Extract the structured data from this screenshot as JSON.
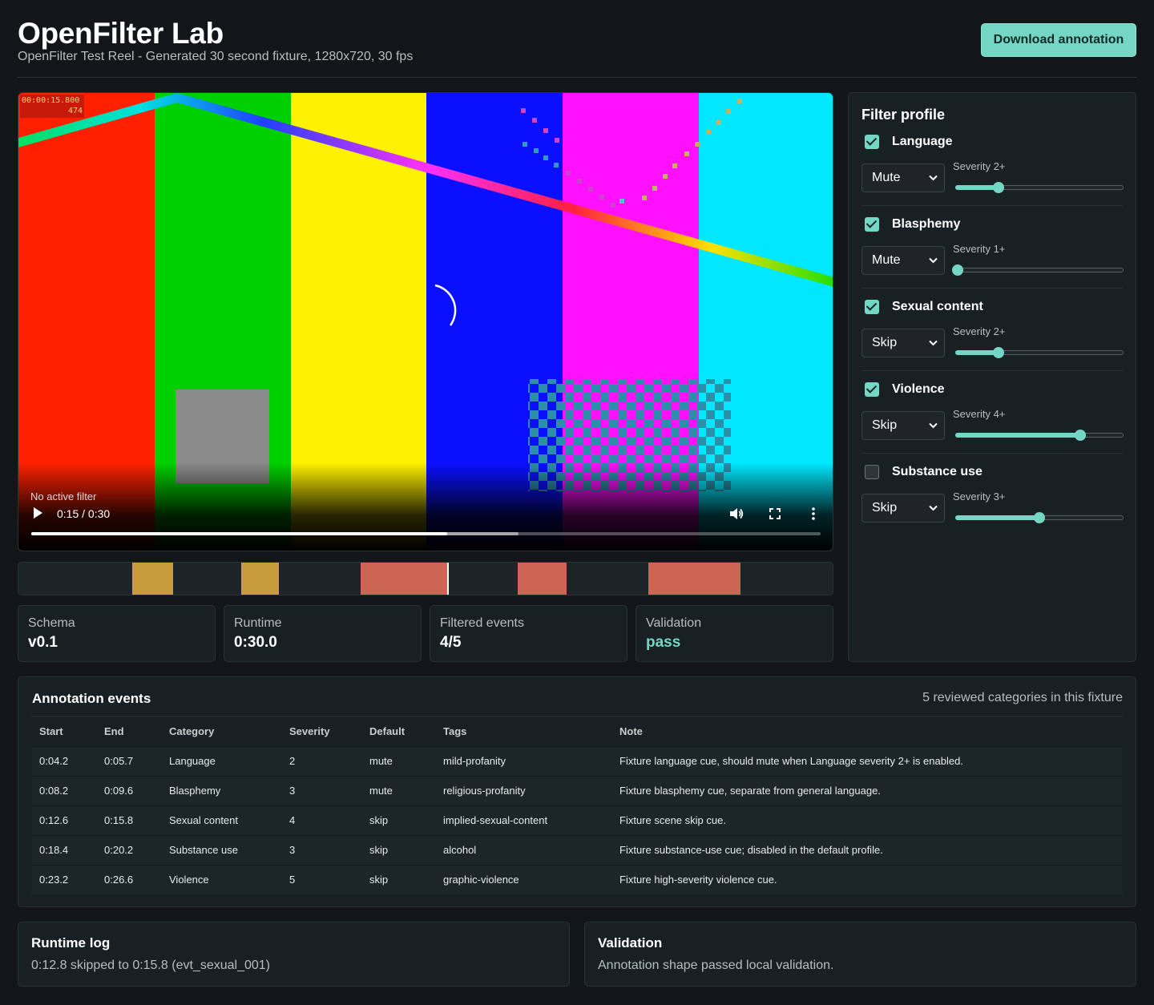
{
  "header": {
    "title": "OpenFilter Lab",
    "subtitle": "OpenFilter Test Reel - Generated 30 second fixture, 1280x720, 30 fps",
    "download_label": "Download annotation"
  },
  "player": {
    "timecode": "00:00:15.800",
    "frame": "474",
    "filter_status": "No active filter",
    "time_readout": "0:15 / 0:30",
    "played_fraction": 0.527,
    "buffered_fraction": 0.617,
    "icons": [
      "play-icon",
      "volume-icon",
      "fullscreen-icon",
      "more-vertical-icon"
    ]
  },
  "timeline": {
    "duration_seconds": 30,
    "cursor_seconds": 15.8,
    "segments": [
      {
        "start": 4.2,
        "end": 5.7,
        "action": "mute"
      },
      {
        "start": 8.2,
        "end": 9.6,
        "action": "mute"
      },
      {
        "start": 12.6,
        "end": 15.8,
        "action": "skip"
      },
      {
        "start": 18.4,
        "end": 20.2,
        "action": "skip"
      },
      {
        "start": 23.2,
        "end": 26.6,
        "action": "skip"
      }
    ],
    "colors": {
      "mute": "#c89b3c",
      "skip": "#cb6655"
    }
  },
  "stats": [
    {
      "label": "Schema",
      "value": "v0.1"
    },
    {
      "label": "Runtime",
      "value": "0:30.0"
    },
    {
      "label": "Filtered events",
      "value": "4/5"
    },
    {
      "label": "Validation",
      "value": "pass"
    }
  ],
  "profile": {
    "title": "Filter profile",
    "categories": [
      {
        "name": "Language",
        "enabled": true,
        "action": "Mute",
        "severity_label": "Severity 2+",
        "severity": 2
      },
      {
        "name": "Blasphemy",
        "enabled": true,
        "action": "Mute",
        "severity_label": "Severity 1+",
        "severity": 1
      },
      {
        "name": "Sexual content",
        "enabled": true,
        "action": "Skip",
        "severity_label": "Severity 2+",
        "severity": 2
      },
      {
        "name": "Violence",
        "enabled": true,
        "action": "Skip",
        "severity_label": "Severity 4+",
        "severity": 4
      },
      {
        "name": "Substance use",
        "enabled": false,
        "action": "Skip",
        "severity_label": "Severity 3+",
        "severity": 3
      }
    ],
    "severity_min": 1,
    "severity_max": 5
  },
  "events": {
    "title": "Annotation events",
    "meta": "5 reviewed categories in this fixture",
    "columns": [
      "Start",
      "End",
      "Category",
      "Severity",
      "Default",
      "Tags",
      "Note"
    ],
    "rows": [
      [
        "0:04.2",
        "0:05.7",
        "Language",
        "2",
        "mute",
        "mild-profanity",
        "Fixture language cue, should mute when Language severity 2+ is enabled."
      ],
      [
        "0:08.2",
        "0:09.6",
        "Blasphemy",
        "3",
        "mute",
        "religious-profanity",
        "Fixture blasphemy cue, separate from general language."
      ],
      [
        "0:12.6",
        "0:15.8",
        "Sexual content",
        "4",
        "skip",
        "implied-sexual-content",
        "Fixture scene skip cue."
      ],
      [
        "0:18.4",
        "0:20.2",
        "Substance use",
        "3",
        "skip",
        "alcohol",
        "Fixture substance-use cue; disabled in the default profile."
      ],
      [
        "0:23.2",
        "0:26.6",
        "Violence",
        "5",
        "skip",
        "graphic-violence",
        "Fixture high-severity violence cue."
      ]
    ]
  },
  "runtime_log": {
    "title": "Runtime log",
    "text": "0:12.8 skipped to 0:15.8 (evt_sexual_001)"
  },
  "validation": {
    "title": "Validation",
    "text": "Annotation shape passed local validation."
  },
  "colors": {
    "accent": "#74d6c4",
    "background": "#121619",
    "panel": "#192024"
  }
}
